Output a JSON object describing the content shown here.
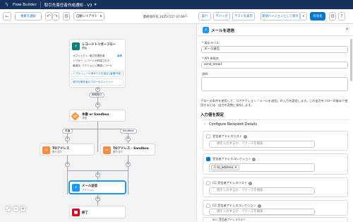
{
  "app": {
    "name": "Flow Builder",
    "tab_title": "取引先責任者作成通知 - V3"
  },
  "toolbar": {
    "back_label": "← 戻る",
    "new_element_label": "要素を選択",
    "layout_label": "自動レイアウト",
    "last_saved": "最終保存日 2025/7/27 07:06",
    "run_label": "実行",
    "debug_label": "デバッグ",
    "test_label": "テストを表示",
    "save_as_label": "新規バージョンとして保存",
    "activate_label": "有効化"
  },
  "canvas": {
    "start": {
      "title": "レコードトリガーフロー",
      "subtitle": "開始",
      "object_label": "オブジェクト: 取引先責任者",
      "edit_label": "編集",
      "trigger_label": "トリガー: レコードが作成された",
      "run_label": "最適化: アクションと関連レコード",
      "schedule_link": "+ スケジュール済みパスを追加 (省略可能)",
      "flow_link": "現行先責任者のフローのエントリー",
      "info_badge": "①"
    },
    "entry_pill": "即時実行",
    "decision": {
      "title": "本番 or Sandbox",
      "subtitle": "決定"
    },
    "path_left_pill": "本番",
    "path_right_pill": "Sandbox",
    "assign_left": {
      "title": "TOアドレス",
      "subtitle": "割り当て"
    },
    "assign_right": {
      "title": "TOアドレス - Sandbox",
      "subtitle": "割り当て"
    },
    "action": {
      "title": "メール送信",
      "subtitle": "アクション"
    },
    "end": {
      "title": "終了"
    }
  },
  "panel": {
    "title": "メールを送信",
    "display_label_caption": "* 表示ラベル",
    "display_label_value": "メール送信",
    "api_name_caption": "* API 参照名",
    "api_name_value": "send_email",
    "description_caption": "説明",
    "help_text": "フローの条件を使用して、コアアクション「メールを送信」の入力を設定します。この出力をフローの後半で使用するには、出力を変数に保存します。",
    "input_section": "入力値を設定",
    "subsection": "Configure Recipient Details",
    "fields": [
      {
        "label": "受信者アドレスリスト",
        "placeholder": "値を入力するか、リソースを検索..."
      },
      {
        "label": "受信者アドレスコレクション",
        "chip": "to_address"
      },
      {
        "label": "CC 受信者アドレスリスト",
        "placeholder": "値を入力するか、リソースを検索..."
      },
      {
        "label": "CC 受信者アドレスコレクション",
        "placeholder": "値を入力するか、リソースを検索..."
      },
      {
        "label": "BCC 受信者アドレスリスト"
      }
    ]
  },
  "colors": {
    "header": "#16325c",
    "brand": "#0176d3",
    "decision": "#ff9a3c",
    "assign": "#ff8a3c",
    "action": "#1b96ff",
    "end": "#ea001e"
  }
}
